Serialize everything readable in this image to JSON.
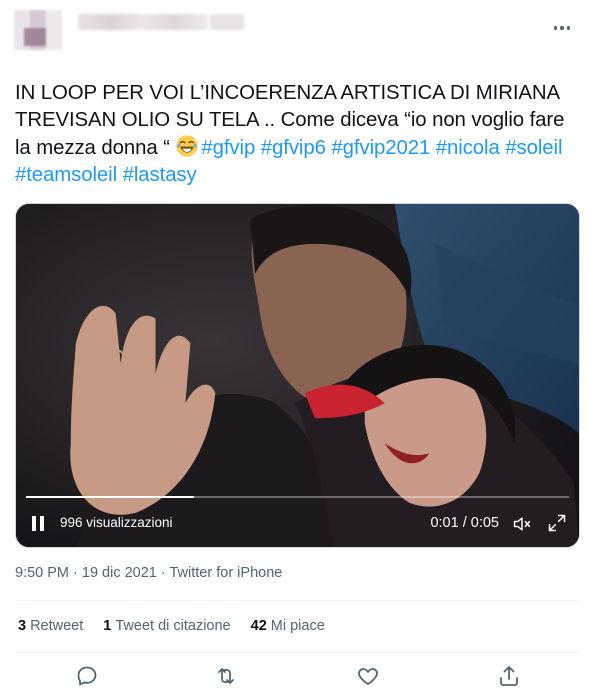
{
  "tweet": {
    "text_plain": "IN LOOP PER VOI L’INCOERENZA ARTISTICA DI MIRIANA TREVISAN OLIO SU TELA .. Come diceva “io non voglio fare la mezza donna “ ",
    "emoji": "face-with-tears-of-joy",
    "hashtags": [
      "#gfvip",
      "#gfvip6",
      "#gfvip2021",
      "#nicola",
      "#soleil",
      "#teamsoleil",
      "#lastasy"
    ]
  },
  "video": {
    "views": "996 visualizzazioni",
    "time": "0:01 / 0:05",
    "progress": 0.31
  },
  "meta": {
    "time": "9:50 PM",
    "sep1": " · ",
    "date": "19 dic 2021",
    "sep2": " · ",
    "source": "Twitter for iPhone"
  },
  "stats": {
    "retweets_count": "3",
    "retweets_label": "Retweet",
    "quotes_count": "1",
    "quotes_label": "Tweet di citazione",
    "likes_count": "42",
    "likes_label": "Mi piace"
  },
  "colors": {
    "link": "#1d9bf0",
    "text": "#0f1419",
    "muted": "#536471",
    "divider": "#eff3f4"
  },
  "icons": [
    "more-icon",
    "pause-icon",
    "mute-icon",
    "expand-icon",
    "reply-icon",
    "retweet-icon",
    "like-icon",
    "share-icon"
  ]
}
